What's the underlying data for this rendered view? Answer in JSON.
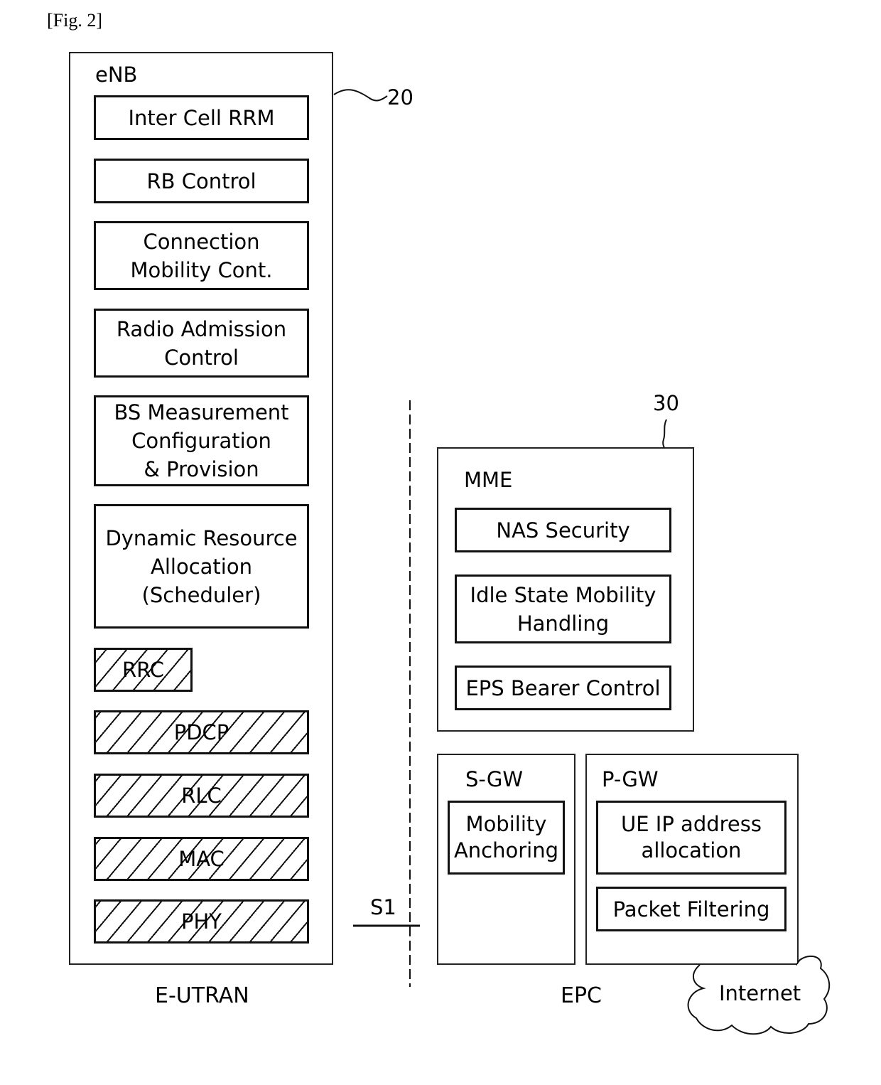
{
  "figure_label": "[Fig. 2]",
  "enb": {
    "title": "eNB",
    "ref": "20",
    "functions": [
      "Inter Cell RRM",
      "RB Control",
      "Connection\nMobility Cont.",
      "Radio Admission\nControl",
      "BS Measurement\nConfiguration\n& Provision",
      "Dynamic Resource\nAllocation\n(Scheduler)"
    ],
    "protocol_layers": [
      "RRC",
      "PDCP",
      "RLC",
      "MAC",
      "PHY"
    ],
    "caption": "E-UTRAN"
  },
  "interface": {
    "label": "S1"
  },
  "epc": {
    "caption": "EPC",
    "mme": {
      "title": "MME",
      "ref": "30",
      "functions": [
        "NAS Security",
        "Idle State Mobility\nHandling",
        "EPS Bearer Control"
      ]
    },
    "sgw": {
      "title": "S-GW",
      "functions": [
        "Mobility\nAnchoring"
      ]
    },
    "pgw": {
      "title": "P-GW",
      "functions": [
        "UE IP address\nallocation",
        "Packet Filtering"
      ]
    }
  },
  "internet": {
    "label": "Internet"
  }
}
